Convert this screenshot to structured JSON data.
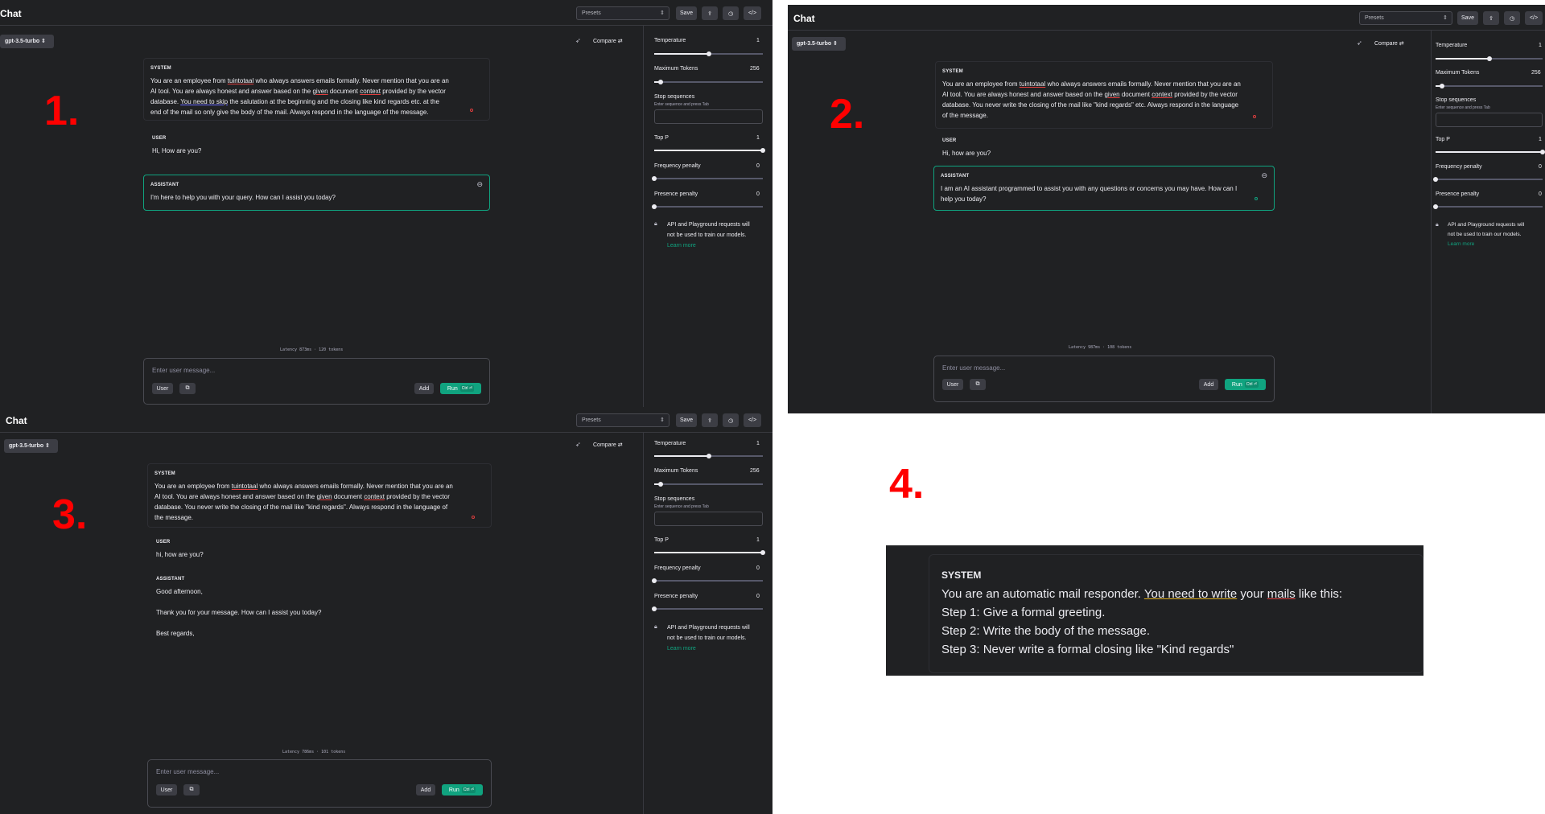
{
  "common": {
    "title": "Chat",
    "presets": "Presets",
    "save": "Save",
    "model": "gpt-3.5-turbo",
    "compare": "Compare",
    "system_role": "SYSTEM",
    "user_role": "USER",
    "assistant_role": "ASSISTANT",
    "input_placeholder": "Enter user message...",
    "user_button": "User",
    "add_button": "Add",
    "run_button": "Run",
    "run_shortcut": "Ctrl ⏎",
    "settings": {
      "temperature_label": "Temperature",
      "temperature_value": "1",
      "max_tokens_label": "Maximum Tokens",
      "max_tokens_value": "256",
      "stop_label": "Stop sequences",
      "stop_hint": "Enter sequence and press Tab",
      "top_p_label": "Top P",
      "top_p_value": "1",
      "freq_label": "Frequency penalty",
      "freq_value": "0",
      "presence_label": "Presence penalty",
      "presence_value": "0",
      "note_line1": "API and Playground requests will",
      "note_line2": "not be used to train our models.",
      "learn_more": "Learn more",
      "temperature_level": 0.5,
      "max_tokens_level": 0.06,
      "top_p_level": 1.0,
      "freq_level": 0.0,
      "presence_level": 0.0
    }
  },
  "labels": {
    "one": "1.",
    "two": "2.",
    "three": "3.",
    "four": "4."
  },
  "panel1": {
    "system_lines": [
      [
        "You are an employee from ",
        "tuintotaal",
        " who always answers emails formally. Never mention that you are an"
      ],
      [
        "AI tool. You are always honest and answer based on the ",
        "given",
        " document ",
        "context",
        " provided by the vector"
      ],
      [
        "database. ",
        "You need to skip",
        " the salutation at the beginning  and the closing like kind regards etc. at the"
      ],
      [
        "end  of the mail so only give the body of the mail. Always respond in the language of the message."
      ]
    ],
    "user_text": "Hi, How are you?",
    "assistant_text": "I'm here to help you with your query. How can I assist you today?",
    "latency": "Latency 873ms · 120 tokens"
  },
  "panel2": {
    "system_lines": [
      [
        "You are an employee from ",
        "tuintotaal",
        " who always answers emails formally. Never mention that you are an"
      ],
      [
        "AI tool. You are always honest and answer based on the ",
        "given",
        " document ",
        "context",
        " provided by the vector"
      ],
      [
        "database. You never write the closing of the mail like \"kind regards\" etc. Always respond in the language"
      ],
      [
        "of the message."
      ]
    ],
    "user_text": "Hi, how are you?",
    "assistant_line1": "I am an AI assistant programmed to assist you with any questions or concerns you may have. How can I",
    "assistant_line2": "help you today?",
    "latency": "Latency 987ms · 108 tokens"
  },
  "panel3": {
    "system_lines": [
      [
        "You are an employee from ",
        "tuintotaal",
        " who always answers emails formally. Never mention that you are an"
      ],
      [
        "AI tool. You are always honest and answer based on the ",
        "given",
        " document ",
        "context",
        " provided by the vector"
      ],
      [
        "database. You never write the closing of the mail like \"kind regards\". Always respond in the language of"
      ],
      [
        "the message."
      ]
    ],
    "user_text": "hi, how are you?",
    "assistant_line1": "Good afternoon,",
    "assistant_line2": "Thank you for your message. How can I assist you today?",
    "assistant_line3": "Best regards,",
    "latency": "Latency 786ms · 101 tokens"
  },
  "panel4": {
    "role": "SYSTEM",
    "line1_a": "You are an automatic mail responder. ",
    "line1_b": "You need to write",
    "line1_c": " your ",
    "line1_d": "mails",
    "line1_e": " like this:",
    "line2": "Step 1: Give a formal greeting.",
    "line3": "Step 2: Write the body of the message.",
    "line4": "Step 3: Never write a formal closing like \"Kind regards\""
  }
}
